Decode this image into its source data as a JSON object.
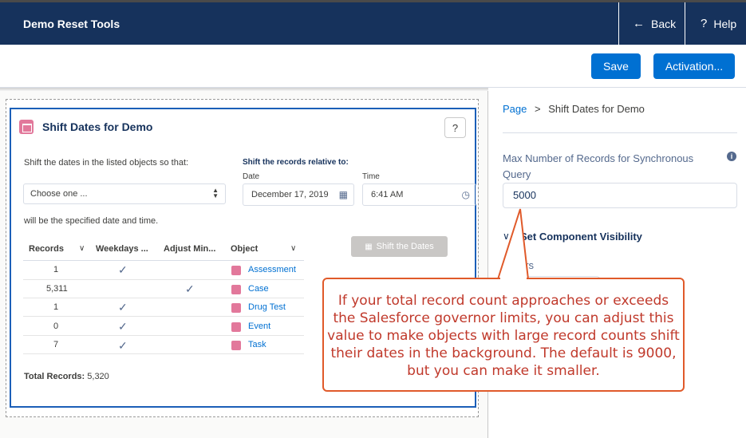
{
  "header": {
    "app_title": "Demo Reset Tools",
    "back_label": "Back",
    "help_label": "Help"
  },
  "toolbar": {
    "save_label": "Save",
    "activation_label": "Activation..."
  },
  "card": {
    "title": "Shift Dates for Demo",
    "help_symbol": "?",
    "instruction": "Shift the dates in the listed objects so that:",
    "relative_label": "Shift the records relative to:",
    "date_label": "Date",
    "time_label": "Time",
    "choose_placeholder": "Choose one ...",
    "date_value": "December 17, 2019",
    "time_value": "6:41 AM",
    "specified_text": "will be the specified date and time.",
    "shift_button": "Shift the Dates",
    "columns": [
      "Records",
      "Weekdays ...",
      "Adjust Min...",
      "Object"
    ],
    "rows": [
      {
        "records": "1",
        "weekdays": true,
        "adjust": false,
        "object": "Assessment"
      },
      {
        "records": "5,311",
        "weekdays": false,
        "adjust": true,
        "object": "Case"
      },
      {
        "records": "1",
        "weekdays": true,
        "adjust": false,
        "object": "Drug Test"
      },
      {
        "records": "0",
        "weekdays": true,
        "adjust": false,
        "object": "Event"
      },
      {
        "records": "7",
        "weekdays": true,
        "adjust": false,
        "object": "Task"
      }
    ],
    "total_label": "Total Records:",
    "total_value": "5,320"
  },
  "sidebar": {
    "breadcrumb_root": "Page",
    "breadcrumb_sep": ">",
    "breadcrumb_current": "Shift Dates for Demo",
    "field_label": "Max Number of Records for Synchronous Query",
    "field_value": "5000",
    "section_title": "Set Component Visibility",
    "users_label": "ers"
  },
  "callout": {
    "text": "If your total record count approaches or exceeds the Salesforce governor limits, you can adjust this value to make objects with large record counts shift their dates in the background. The default is 9000, but you can make it smaller."
  },
  "colors": {
    "header_bg": "#16325c",
    "brand": "#0070d2",
    "callout_border": "#e05a2a",
    "callout_text": "#c0392b",
    "object_icon": "#e2789b"
  }
}
